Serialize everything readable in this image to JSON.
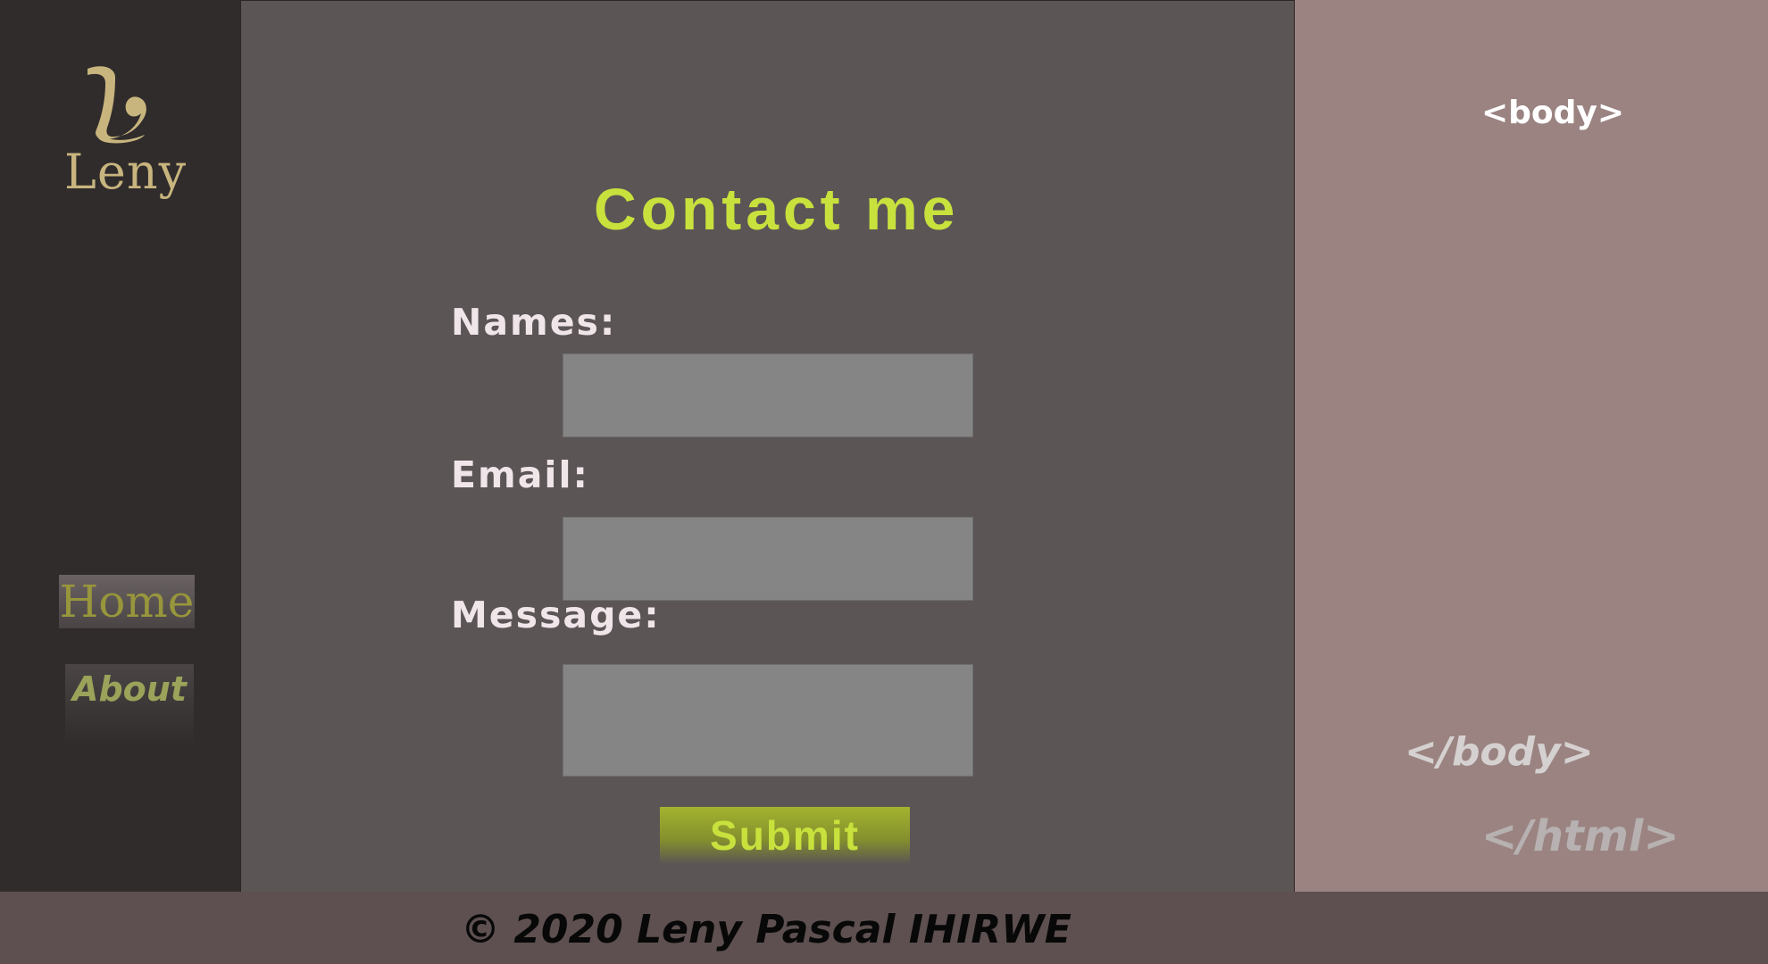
{
  "brand": {
    "name": "Leny",
    "mark": "L",
    "logo_icon": "script-l-logo-icon"
  },
  "navigation": {
    "items": [
      {
        "label": "Home",
        "selected": true
      },
      {
        "label": "About",
        "selected": false
      }
    ]
  },
  "contact": {
    "title": "Contact me",
    "fields": {
      "names": {
        "label": "Names:",
        "value": "",
        "placeholder": ""
      },
      "email": {
        "label": "Email:",
        "value": "",
        "placeholder": ""
      },
      "message": {
        "label": "Message:",
        "value": "",
        "placeholder": ""
      }
    },
    "submit_label": "Submit"
  },
  "code_decor": {
    "open_body": "<body>",
    "close_body": "</body>",
    "close_html": "</html>"
  },
  "footer": {
    "copyright": "© 2020 Leny Pascal IHIRWE"
  },
  "colors": {
    "sidebar": "#302c2c",
    "main": "#5b5555",
    "right_panel": "#9a8381",
    "footer": "#5e5050",
    "accent": "#c8e13d",
    "logo": "#c8b57e",
    "input_background": "#858585"
  }
}
